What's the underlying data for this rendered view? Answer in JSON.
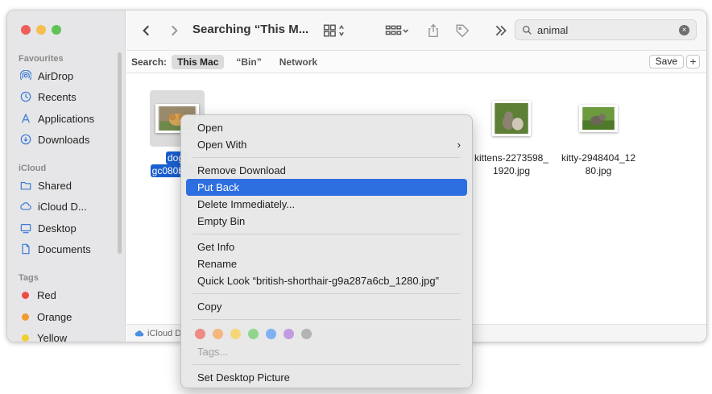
{
  "window": {
    "title": "Searching “This M...",
    "search": {
      "value": "animal",
      "placeholder": "Search"
    }
  },
  "sidebar": {
    "favourites_label": "Favourites",
    "favourites": [
      {
        "label": "AirDrop",
        "icon": "airdrop-icon"
      },
      {
        "label": "Recents",
        "icon": "clock-icon"
      },
      {
        "label": "Applications",
        "icon": "applications-icon"
      },
      {
        "label": "Downloads",
        "icon": "download-icon"
      }
    ],
    "icloud_label": "iCloud",
    "icloud": [
      {
        "label": "Shared",
        "icon": "shared-folder-icon"
      },
      {
        "label": "iCloud D...",
        "icon": "cloud-icon"
      },
      {
        "label": "Desktop",
        "icon": "desktop-icon"
      },
      {
        "label": "Documents",
        "icon": "document-icon"
      }
    ],
    "tags_label": "Tags",
    "tags": [
      {
        "label": "Red",
        "color": "#ee4b41"
      },
      {
        "label": "Orange",
        "color": "#f29b2c"
      },
      {
        "label": "Yellow",
        "color": "#f4cd2f"
      }
    ]
  },
  "scopebar": {
    "label": "Search:",
    "scopes": [
      "This Mac",
      "“Bin”",
      "Network"
    ],
    "save": "Save",
    "add": "+"
  },
  "files": [
    {
      "line1": "dog-",
      "line2": "gc080b...19",
      "selected": true
    },
    {
      "line1": "kittens-2273598_",
      "line2": "1920.jpg",
      "selected": false
    },
    {
      "line1": "kitty-2948404_12",
      "line2": "80.jpg",
      "selected": false
    }
  ],
  "pathbar": {
    "label": "iCloud D"
  },
  "context_menu": {
    "open": "Open",
    "open_with": "Open With",
    "remove_download": "Remove Download",
    "put_back": "Put Back",
    "delete_immediately": "Delete Immediately...",
    "empty_bin": "Empty Bin",
    "get_info": "Get Info",
    "rename": "Rename",
    "quick_look": "Quick Look “british-shorthair-g9a287a6cb_1280.jpg”",
    "copy": "Copy",
    "tag_colors": [
      "#f08a84",
      "#f5b77e",
      "#f5d77a",
      "#8fd58e",
      "#7fb0f1",
      "#c39ae0",
      "#b3b3b3"
    ],
    "tags": "Tags...",
    "set_desktop_picture": "Set Desktop Picture"
  }
}
